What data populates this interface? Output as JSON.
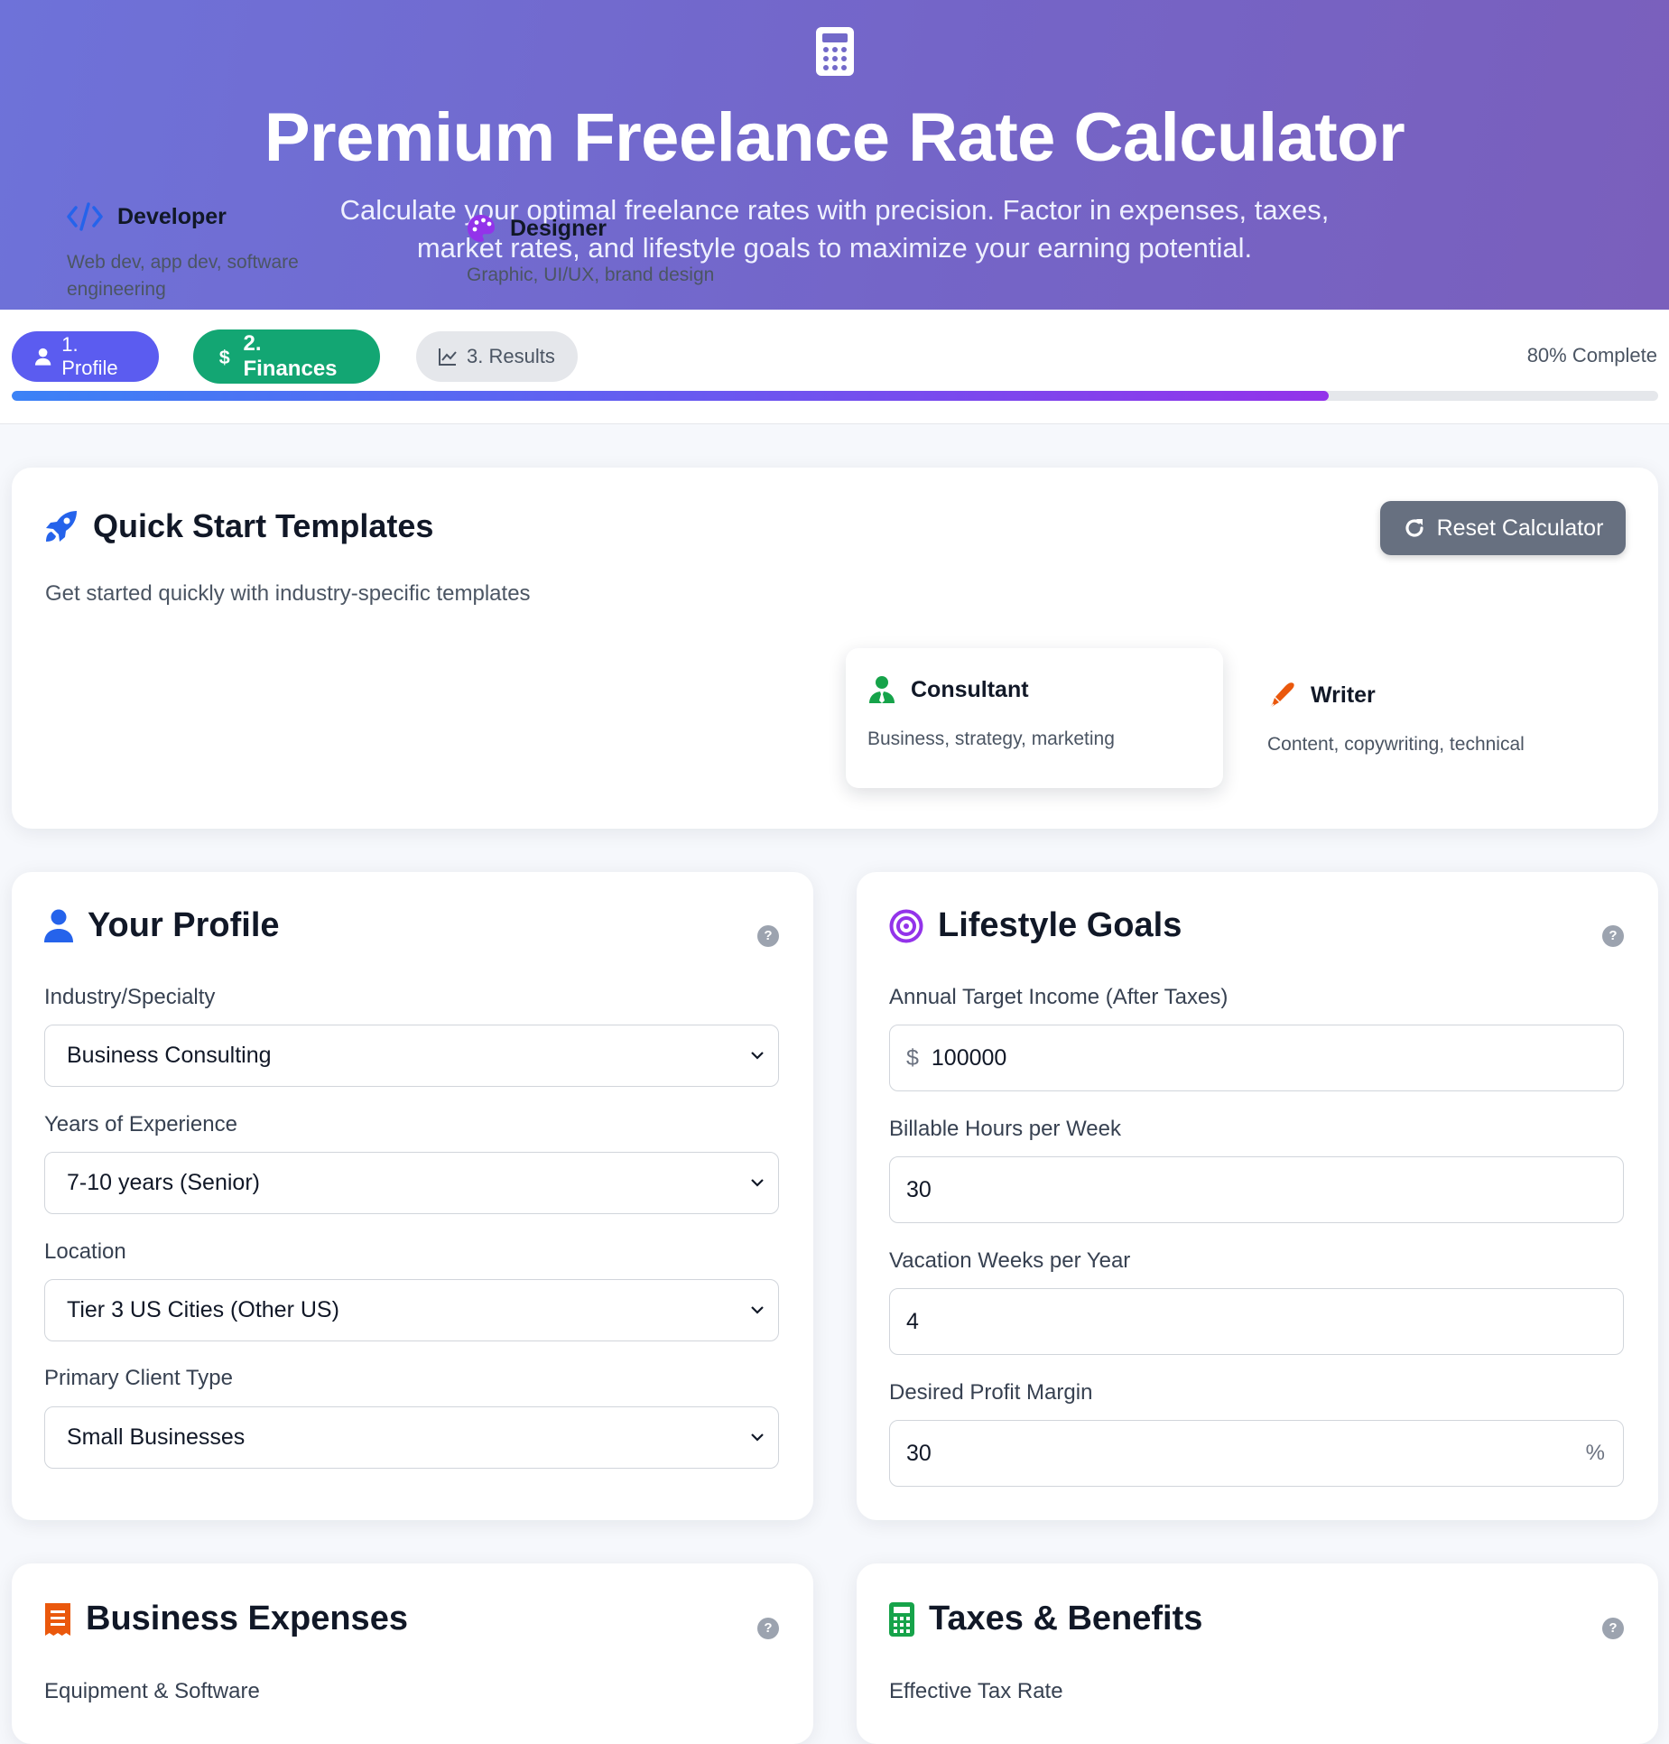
{
  "header": {
    "title": "Premium Freelance Rate Calculator",
    "subtitle": "Calculate your optimal freelance rates with precision. Factor in expenses, taxes, market rates, and lifestyle goals to maximize your earning potential."
  },
  "steps": {
    "items": [
      {
        "label": "1. Profile",
        "icon": "user-icon"
      },
      {
        "label": "2. Finances",
        "icon": "dollar-icon"
      },
      {
        "label": "3. Results",
        "icon": "chart-line-icon"
      }
    ],
    "active": 1,
    "progress_label": "80% Complete",
    "progress_percent": 80
  },
  "quick_start": {
    "title": "Quick Start Templates",
    "subtitle": "Get started quickly with industry-specific templates",
    "reset_label": "Reset Calculator",
    "templates": [
      {
        "name": "Developer",
        "desc": "Web dev, app dev, software engineering",
        "icon": "code-icon",
        "color": "#2563eb"
      },
      {
        "name": "Designer",
        "desc": "Graphic, UI/UX, brand design",
        "icon": "palette-icon",
        "color": "#9333ea"
      },
      {
        "name": "Consultant",
        "desc": "Business, strategy, marketing",
        "icon": "user-tie-icon",
        "color": "#16a34a"
      },
      {
        "name": "Writer",
        "desc": "Content, copywriting, technical",
        "icon": "pen-icon",
        "color": "#ea580c"
      }
    ],
    "selected": 2
  },
  "profile": {
    "title": "Your Profile",
    "fields": [
      {
        "label": "Industry/Specialty",
        "value": "Business Consulting"
      },
      {
        "label": "Years of Experience",
        "value": "7-10 years (Senior)"
      },
      {
        "label": "Location",
        "value": "Tier 3 US Cities (Other US)"
      },
      {
        "label": "Primary Client Type",
        "value": "Small Businesses"
      }
    ]
  },
  "goals": {
    "title": "Lifestyle Goals",
    "fields": [
      {
        "label": "Annual Target Income (After Taxes)",
        "value": "100000",
        "prefix": "$"
      },
      {
        "label": "Billable Hours per Week",
        "value": "30"
      },
      {
        "label": "Vacation Weeks per Year",
        "value": "4"
      },
      {
        "label": "Desired Profit Margin",
        "value": "30",
        "suffix": "%"
      }
    ]
  },
  "expenses": {
    "title": "Business Expenses",
    "first_label": "Equipment & Software"
  },
  "taxes": {
    "title": "Taxes & Benefits",
    "first_label": "Effective Tax Rate"
  },
  "help_glyph": "?",
  "colors": {
    "accent": "#5b5cf0",
    "success": "#13a673",
    "header_gradient_start": "#6e72d9",
    "header_gradient_end": "#7a5fbc"
  }
}
